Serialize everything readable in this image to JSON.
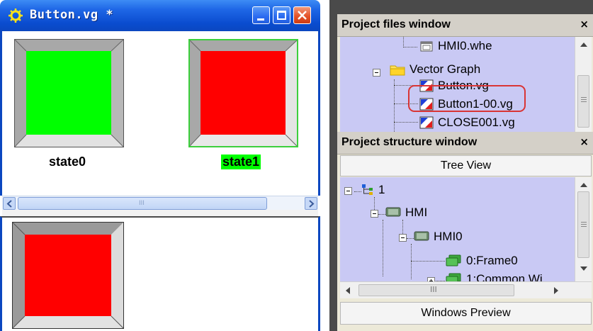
{
  "vg_window": {
    "title": "Button.vg *",
    "state0_label": "state0",
    "state1_label": "state1",
    "scroll_grip": "III"
  },
  "files_panel": {
    "title": "Project files window",
    "close": "×",
    "items": [
      {
        "label": "HMI0.whe"
      },
      {
        "label": "Vector Graph"
      },
      {
        "label": "Button.vg"
      },
      {
        "label": "Button1-00.vg"
      },
      {
        "label": "CLOSE001.vg"
      }
    ]
  },
  "structure_panel": {
    "title": "Project structure window",
    "close": "×",
    "tree_view_label": "Tree View",
    "windows_preview_label": "Windows Preview",
    "scroll_grip": "III",
    "items": [
      {
        "label": "1"
      },
      {
        "label": "HMI"
      },
      {
        "label": "HMI0"
      },
      {
        "label": "0:Frame0"
      },
      {
        "label": "1:Common Wi"
      }
    ]
  },
  "colors": {
    "state_green": "#00ff00",
    "state_red": "#ff0000",
    "selection_red": "#d93535",
    "tree_bg": "#c9c9f4",
    "titlebar_blue": "#0b47c0"
  }
}
